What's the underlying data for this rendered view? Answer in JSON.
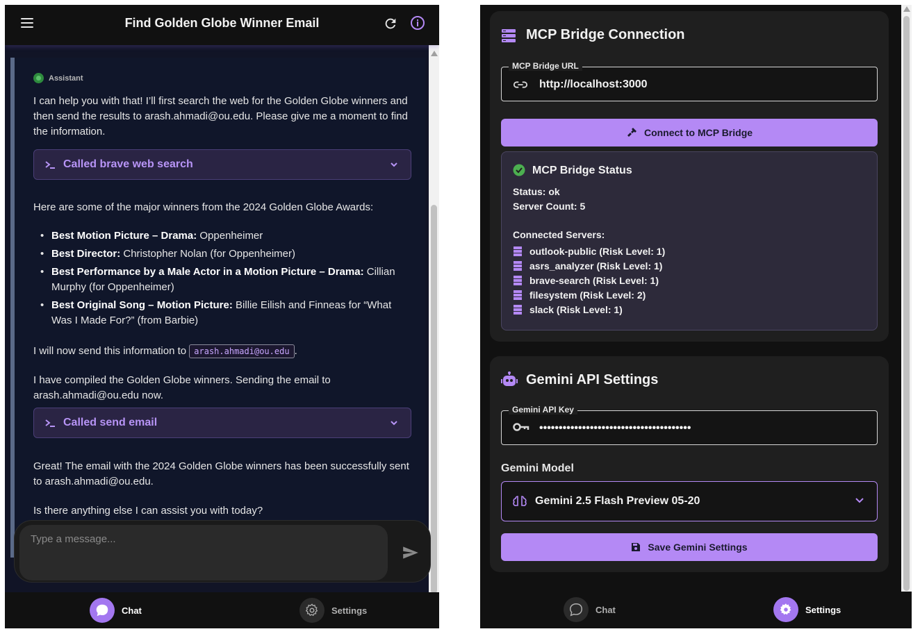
{
  "chat_window": {
    "title": "Find Golden Globe Winner Email",
    "message": {
      "sender": "Assistant",
      "intro": "I can help you with that! I’ll first search the web for the Golden Globe winners and then send the results to arash.ahmadi@ou.edu. Please give me a moment to find the information.",
      "tool_call_1": "Called brave web search",
      "winners_intro": "Here are some of the major winners from the 2024 Golden Globe Awards:",
      "winners": [
        {
          "category": "Best Motion Picture – Drama:",
          "winner": " Oppenheimer"
        },
        {
          "category": "Best Director:",
          "winner": " Christopher Nolan (for Oppenheimer)"
        },
        {
          "category": "Best Performance by a Male Actor in a Motion Picture – Drama:",
          "winner": " Cillian Murphy (for Oppenheimer)"
        },
        {
          "category": "Best Original Song – Motion Picture:",
          "winner": " Billie Eilish and Finneas for “What Was I Made For?” (from Barbie)"
        }
      ],
      "send_prefix": "I will now send this information to ",
      "send_email_code": "arash.ahmadi@ou.edu",
      "send_suffix": ".",
      "compiled": "I have compiled the Golden Globe winners. Sending the email to arash.ahmadi@ou.edu now.",
      "tool_call_2": "Called send email",
      "success": "Great! The email with the 2024 Golden Globe winners has been successfully sent to arash.ahmadi@ou.edu.",
      "followup": "Is there anything else I can assist you with today?"
    },
    "input_placeholder": "Type a message...",
    "nav": {
      "chat_label": "Chat",
      "settings_label": "Settings",
      "active": "Chat"
    }
  },
  "settings_window": {
    "mcp": {
      "title": "MCP Bridge Connection",
      "url_label": "MCP Bridge URL",
      "url_value": "http://localhost:3000",
      "connect_label": "Connect to MCP Bridge",
      "status_title": "MCP Bridge Status",
      "status_line": "Status: ok",
      "server_count_line": "Server Count: 5",
      "connected_servers_label": "Connected Servers:",
      "servers": [
        "outlook-public (Risk Level: 1)",
        "asrs_analyzer (Risk Level: 1)",
        "brave-search (Risk Level: 1)",
        "filesystem (Risk Level: 2)",
        "slack (Risk Level: 1)"
      ]
    },
    "gemini": {
      "title": "Gemini API Settings",
      "key_label": "Gemini API Key",
      "key_value": "•••••••••••••••••••••••••••••••••••••••",
      "model_label": "Gemini Model",
      "model_value": "Gemini 2.5 Flash Preview 05-20",
      "save_label": "Save Gemini Settings"
    },
    "nav": {
      "chat_label": "Chat",
      "settings_label": "Settings",
      "active": "Settings"
    }
  },
  "colors": {
    "accent": "#b489f5",
    "success": "#4caf50",
    "panel": "#1f1f1f"
  }
}
